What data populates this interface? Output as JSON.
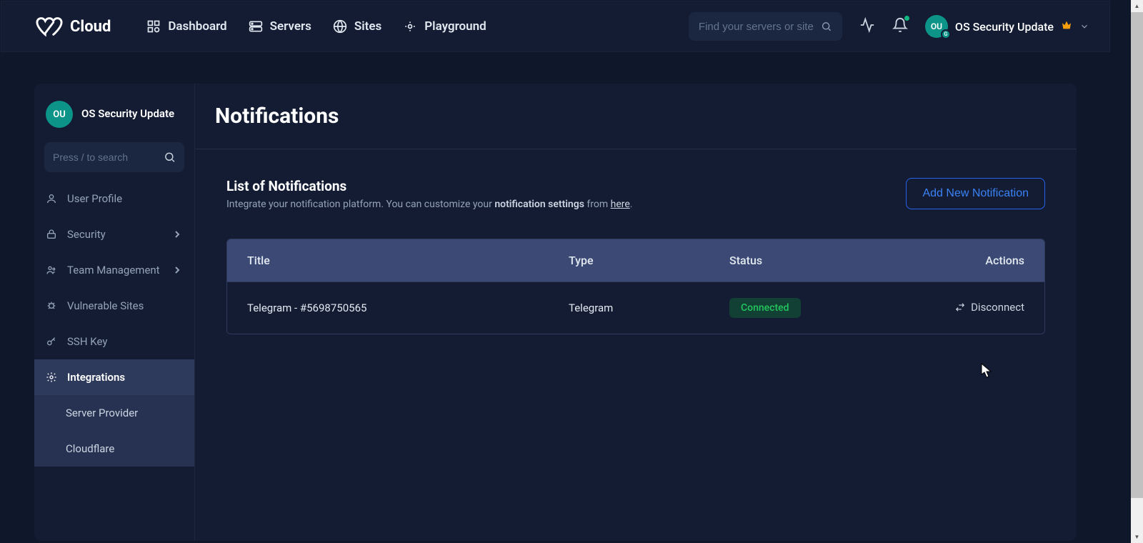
{
  "brand": "Cloud",
  "nav": {
    "dashboard": "Dashboard",
    "servers": "Servers",
    "sites": "Sites",
    "playground": "Playground"
  },
  "topSearch": {
    "placeholder": "Find your servers or sites"
  },
  "topUser": {
    "initials": "OU",
    "sub": "G",
    "name": "OS Security Update"
  },
  "sidebar": {
    "user": {
      "initials": "OU",
      "name": "OS Security Update"
    },
    "search": {
      "placeholder": "Press / to search"
    },
    "items": {
      "profile": "User Profile",
      "security": "Security",
      "team": "Team Management",
      "vuln": "Vulnerable Sites",
      "ssh": "SSH Key",
      "integrations": "Integrations"
    },
    "sub": {
      "serverProvider": "Server Provider",
      "cloudflare": "Cloudflare"
    }
  },
  "page": {
    "title": "Notifications",
    "sectionTitle": "List of Notifications",
    "descPrefix": "Integrate your notification platform. You can customize your ",
    "descBold": "notification settings",
    "descMid": " from ",
    "descLink": "here",
    "descSuffix": ".",
    "addButton": "Add New Notification"
  },
  "table": {
    "headers": {
      "title": "Title",
      "type": "Type",
      "status": "Status",
      "actions": "Actions"
    },
    "rows": [
      {
        "title": "Telegram - #5698750565",
        "type": "Telegram",
        "status": "Connected",
        "action": "Disconnect"
      }
    ]
  }
}
